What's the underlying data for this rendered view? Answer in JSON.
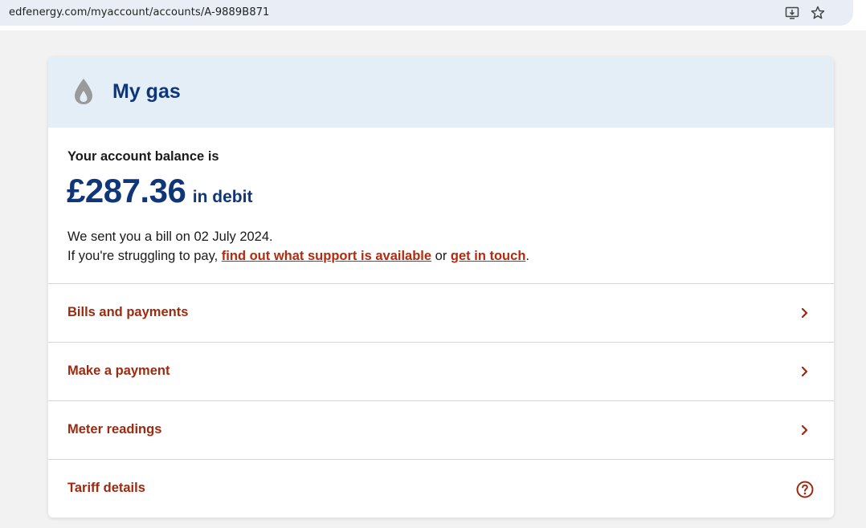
{
  "browser": {
    "url": "edfenergy.com/myaccount/accounts/A-9889B871",
    "icons": [
      "site-info-icon",
      "install-app-icon",
      "bookmark-star-icon"
    ]
  },
  "card": {
    "title": "My gas",
    "title_icon": "gas-flame-icon",
    "balance_label": "Your account balance is",
    "balance_amount": "£287.36",
    "balance_status": "in debit",
    "bill_text": "We sent you a bill on 02 July 2024.",
    "support_prefix": "If you're struggling to pay, ",
    "support_link": "find out what support is available",
    "support_or": " or ",
    "contact_link": "get in touch",
    "support_suffix": "."
  },
  "menu": {
    "items": [
      {
        "label": "Bills and payments",
        "icon": "chevron-right-icon"
      },
      {
        "label": "Make a payment",
        "icon": "chevron-right-icon"
      },
      {
        "label": "Meter readings",
        "icon": "chevron-right-icon"
      },
      {
        "label": "Tariff details",
        "icon": "help-circle-icon"
      }
    ]
  },
  "colors": {
    "brand_navy": "#10367a",
    "link_red": "#b52a0e",
    "menu_red": "#9c2a10",
    "header_bg": "#e4eef7"
  }
}
